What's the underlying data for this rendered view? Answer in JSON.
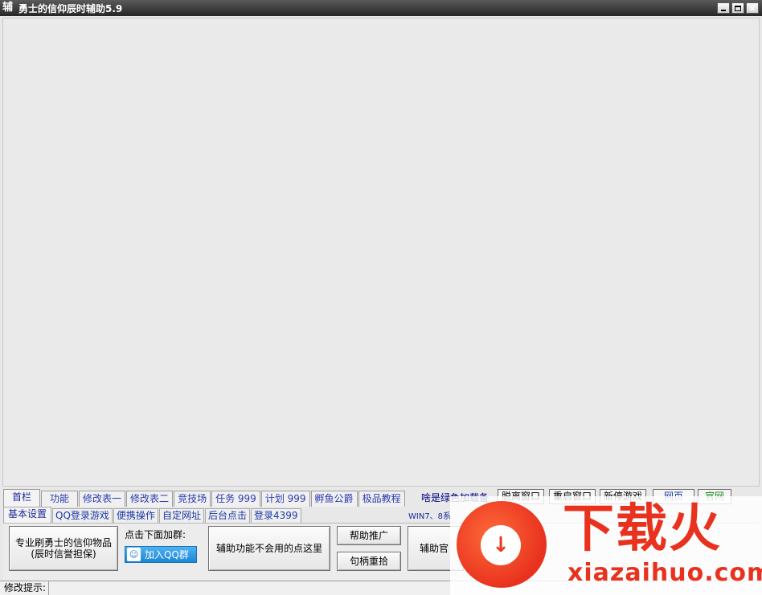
{
  "window": {
    "icon_glyph": "辅",
    "title": "勇士的信仰辰时辅助5.9",
    "controls": [
      "minimize",
      "maximize",
      "close"
    ],
    "close_glyph": "×"
  },
  "tabs_primary": [
    {
      "label": "首栏",
      "active": true
    },
    {
      "label": "功能"
    },
    {
      "label": "修改表一"
    },
    {
      "label": "修改表二"
    },
    {
      "label": "竞技场"
    },
    {
      "label": "任务 999"
    },
    {
      "label": "计划 999"
    },
    {
      "label": "孵鱼公爵"
    },
    {
      "label": "极品教程"
    }
  ],
  "green_link": "啥是绿色加载备",
  "tool_buttons": [
    "脱离窗口",
    "重启窗口",
    "新停游戏",
    "网页",
    "官网"
  ],
  "tabs_secondary": [
    {
      "label": "基本设置",
      "active": true
    },
    {
      "label": "QQ登录游戏"
    },
    {
      "label": "便携操作"
    },
    {
      "label": "自定网址"
    },
    {
      "label": "后台点击"
    },
    {
      "label": "登录4399"
    }
  ],
  "win_note": "WIN7、8系",
  "panel": {
    "promo_line1": "专业刷勇士的信仰物品",
    "promo_line2": "(辰时信誉担保)",
    "hint_label": "点击下面加群:",
    "qq_button": "加入QQ群",
    "help_center": "辅助功能不会用的点这里",
    "help_promo": "帮助推广",
    "handle_reset": "句柄重拾",
    "official": "辅助官"
  },
  "status": {
    "label": "修改提示:",
    "value": ""
  },
  "watermark": {
    "title": "下载火",
    "url": "xiazaihuo.com"
  }
}
